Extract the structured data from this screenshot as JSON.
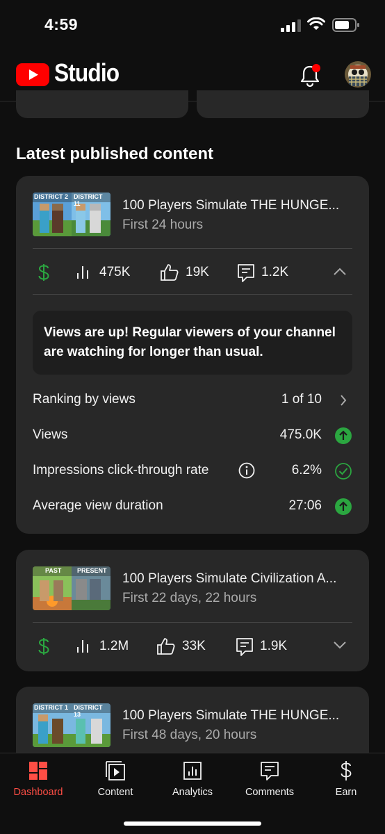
{
  "status_bar": {
    "time": "4:59"
  },
  "header": {
    "brand": "Studio",
    "icons": [
      "youtube-logo",
      "bell-icon",
      "avatar"
    ],
    "accent": "#ff0000"
  },
  "section": {
    "title": "Latest published content"
  },
  "videos": [
    {
      "title": "100 Players Simulate THE HUNGE...",
      "subtitle": "First 24 hours",
      "thumb_labels": [
        "DISTRICT 2",
        "DISTRICT 11"
      ],
      "views": "475K",
      "likes": "19K",
      "comments": "1.2K",
      "expanded": true,
      "insight": "Views are up! Regular viewers of your channel are watching for longer than usual.",
      "stats": [
        {
          "label": "Ranking by views",
          "value": "1 of 10",
          "icon": "chevron-right-icon"
        },
        {
          "label": "Views",
          "value": "475.0K",
          "icon": "arrow-up-circle-icon"
        },
        {
          "label": "Impressions click-through rate",
          "value": "6.2%",
          "icon": "check-circle-icon"
        },
        {
          "label": "Average view duration",
          "value": "27:06",
          "icon": "arrow-up-circle-icon"
        }
      ]
    },
    {
      "title": "100 Players Simulate Civilization A...",
      "subtitle": "First 22 days, 22 hours",
      "thumb_labels": [
        "PAST",
        "PRESENT"
      ],
      "views": "1.2M",
      "likes": "33K",
      "comments": "1.9K",
      "expanded": false
    },
    {
      "title": "100 Players Simulate THE HUNGE...",
      "subtitle": "First 48 days, 20 hours",
      "thumb_labels": [
        "DISTRICT 1",
        "DISTRICT 13"
      ]
    }
  ],
  "nav": [
    {
      "label": "Dashboard",
      "active": true
    },
    {
      "label": "Content"
    },
    {
      "label": "Analytics"
    },
    {
      "label": "Comments"
    },
    {
      "label": "Earn"
    }
  ],
  "colors": {
    "active_nav": "#ff4e45",
    "positive": "#2ba640",
    "money": "#2ba640"
  }
}
